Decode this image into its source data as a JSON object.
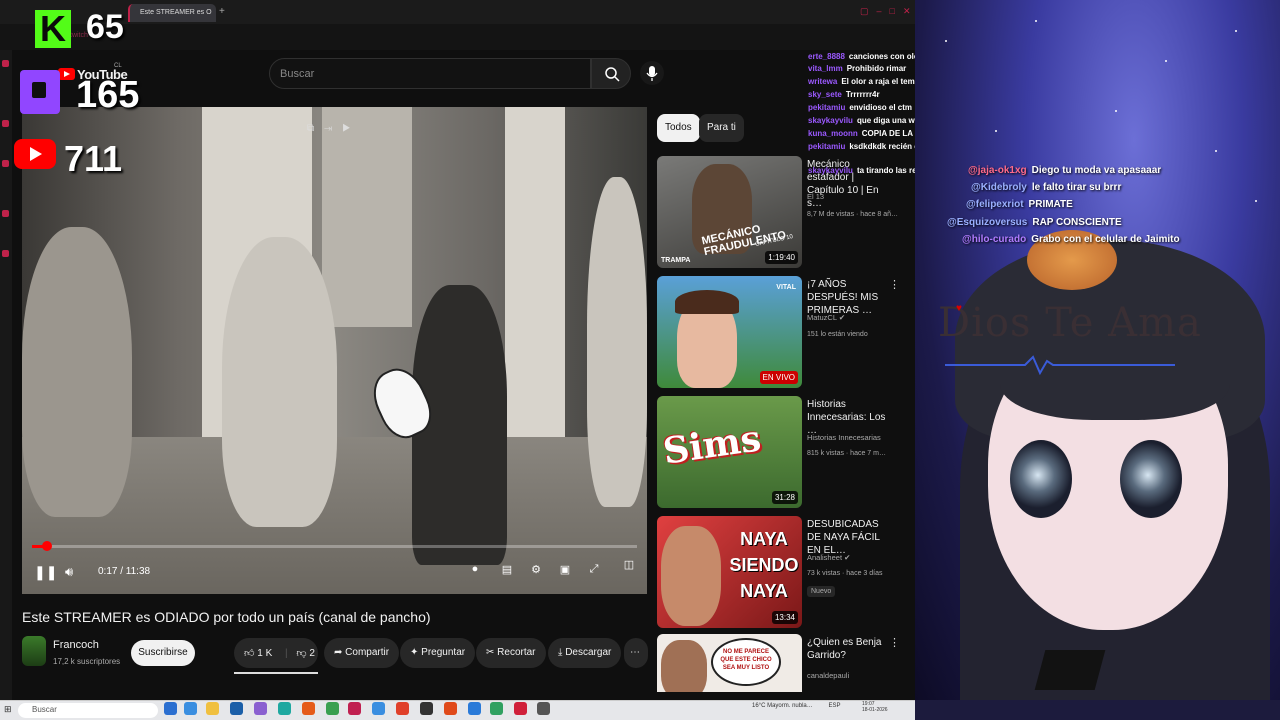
{
  "browser": {
    "tab_title": "Este STREAMER es O",
    "url": "twitch"
  },
  "youtube": {
    "logo": "YouTube",
    "region": "CL",
    "search_placeholder": "Buscar",
    "video": {
      "time": "0:17 / 11:38",
      "progress": 0.024,
      "title": "Este STREAMER es ODIADO por todo un país (canal de pancho)",
      "channel": "Francoch",
      "subscribers": "17,2 k suscriptores",
      "subscribe_label": "Suscribirse",
      "likes": "1 K",
      "dislikes": "2",
      "share_label": "Compartir",
      "ask_label": "Preguntar",
      "clip_label": "Recortar",
      "download_label": "Descargar"
    },
    "chips": [
      "Todos",
      "Para ti"
    ],
    "recommendations": [
      {
        "title": "Mecánico estafador | Capítulo 10 | En s…",
        "channel": "El 13",
        "views": "8,7 M de vistas · hace 8 añ…",
        "badge": "1:19:40",
        "thumb_text": "MECÁNICO FRAUDULENTO",
        "thumb_sub": "CAPÍTULO 10",
        "thumb_brand": "TRAMPA"
      },
      {
        "title": "¡7 AÑOS DESPUÉS! MIS PRIMERAS …",
        "channel": "MatuzCL",
        "views": "151 lo están viendo",
        "badge": "EN VIVO",
        "thumb_brand": "VITAL"
      },
      {
        "title": "Historias Innecesarias: Los …",
        "channel": "Historias Innecesarias",
        "views": "815 k vistas · hace 7 m…",
        "badge": "31:28",
        "thumb_text": "Sims"
      },
      {
        "title": "DESUBICADAS DE NAYA FÁCIL EN EL…",
        "channel": "Analisheet",
        "views": "73 k vistas · hace 3 días",
        "badge": "13:34",
        "tag": "Nuevo",
        "thumb_text": "NAYA SIENDO NAYA"
      },
      {
        "title": "¿Quien es Benja Garrido?",
        "channel": "canaldepauli",
        "views": "",
        "thumb_text": "NO ME PARECE QUE ESTE CHICO SEA MUY LISTO"
      }
    ]
  },
  "viewer_counts": {
    "kick": "65",
    "twitch": "165",
    "youtube": "711"
  },
  "side_chat": [
    {
      "user": "erte_8888",
      "msg": "canciones con olor a ar…"
    },
    {
      "user": "vita_lmm",
      "msg": "Prohibido rimar"
    },
    {
      "user": "writewa",
      "msg": "El olor a raja el tema"
    },
    {
      "user": "sky_sete",
      "msg": "Trrrrrrr4r"
    },
    {
      "user": "pekitamiu",
      "msg": "envidioso el ctm"
    },
    {
      "user": "skaykayvilu",
      "msg": "que diga una wsa nueva"
    },
    {
      "user": "kuna_moonn",
      "msg": "COPIA DE LA COPIA"
    },
    {
      "user": "pekitamiu",
      "msg": "ksdkdkdk recién estaba viendo ese video ksdkdkskg"
    },
    {
      "user": "skaykayvilu",
      "msg": "ta tirando las resicladas"
    }
  ],
  "overlay_chat": [
    {
      "user": "@jaja-ok1xg",
      "msg": "Diego tu moda va apasaaar"
    },
    {
      "user": "@Kidebroly",
      "msg": "le falto tirar su brrr"
    },
    {
      "user": "@felipexriot",
      "msg": "PRIMATE"
    },
    {
      "user": "@Esquizoversus",
      "msg": "RAP CONSCIENTE"
    },
    {
      "user": "@hilo-curado",
      "msg": "Grabo con el celular de Jaimito"
    }
  ],
  "stream_overlay": {
    "banner": "Dios Te Ama"
  },
  "taskbar": {
    "search": "Buscar",
    "weather": "16°C  Mayorm. nubla…",
    "lang": "ESP",
    "time": "19:07",
    "date": "18-01-2026"
  },
  "colors": {
    "youtube_red": "#ff0000",
    "kick_green": "#53fc18",
    "twitch_purple": "#9146ff",
    "accent_pink": "#c0224a"
  }
}
